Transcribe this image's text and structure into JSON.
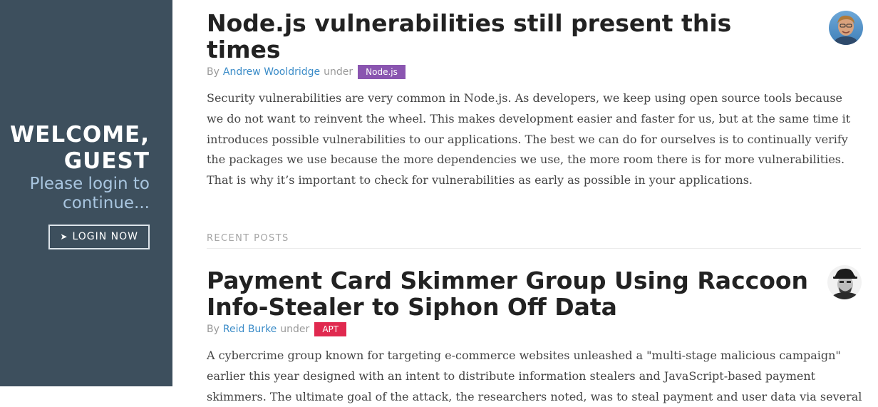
{
  "sidebar": {
    "welcome_line1": "WELCOME,",
    "welcome_line2": "GUEST",
    "hint_line1": "Please login to",
    "hint_line2": "continue...",
    "login_button_icon": "➤",
    "login_button_label": "LOGIN NOW",
    "background_color": "#3d4f5d"
  },
  "featured_post": {
    "title": "Node.js vulnerabilities still present this times",
    "by_label": "By",
    "author": "Andrew Wooldridge",
    "under_label": "under",
    "category": "Node.js",
    "category_color": "#8a55b0",
    "excerpt": "Security vulnerabilities are very common in Node.js. As developers, we keep using open source tools because we do not want to reinvent the wheel. This makes development easier and faster for us, but at the same time it introduces possible vulnerabilities to our applications. The best we can do for ourselves is to continually verify the packages we use because the more dependencies we use, the more room there is for more vulnerabilities. That is why it’s important to check for vulnerabilities as early as possible in your applications."
  },
  "recent_posts": {
    "section_label": "RECENT POSTS",
    "items": [
      {
        "title": "Payment Card Skimmer Group Using Raccoon Info-Stealer to Siphon Off Data",
        "by_label": "By",
        "author": "Reid Burke",
        "under_label": "under",
        "category": "APT",
        "category_color": "#e0294f",
        "excerpt": "A cybercrime group known for targeting e-commerce websites unleashed a \"multi-stage malicious campaign\" earlier this year designed with an intent to distribute information stealers and JavaScript-based payment skimmers. The ultimate goal of the attack, the researchers noted, was to steal payment and user data via several"
      }
    ]
  }
}
